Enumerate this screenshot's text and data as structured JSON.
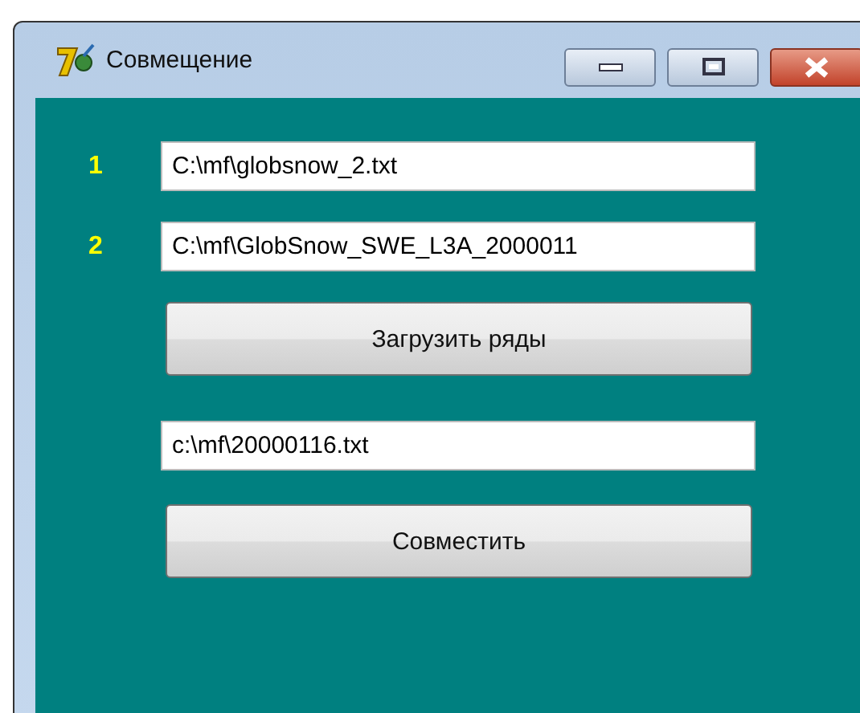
{
  "window": {
    "title": "Совмещение"
  },
  "inputs": [
    {
      "label": "1",
      "value": "C:\\mf\\globsnow_2.txt"
    },
    {
      "label": "2",
      "value": "C:\\mf\\GlobSnow_SWE_L3A_2000011"
    }
  ],
  "load_button": "Загрузить ряды",
  "output_field": {
    "value": "c:\\mf\\20000116.txt"
  },
  "merge_button": "Совместить"
}
